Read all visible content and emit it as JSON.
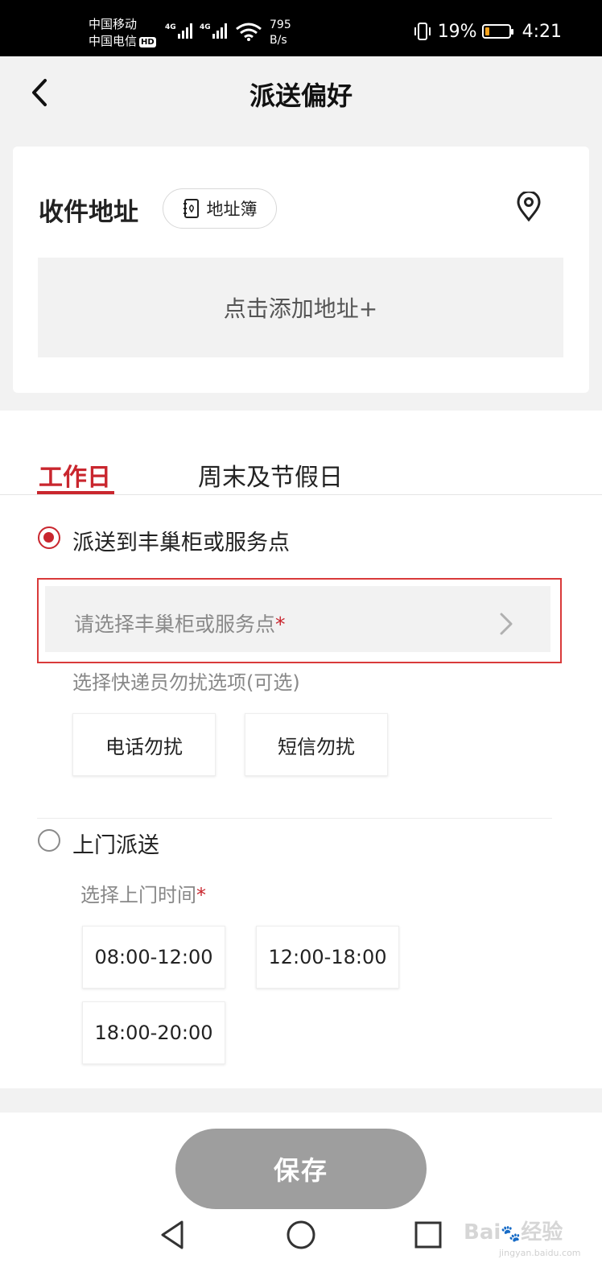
{
  "status_bar": {
    "carrier_1": "中国移动",
    "carrier_2": "中国电信",
    "hd_badge": "HD",
    "net_1": "4G",
    "net_2": "4G",
    "speed_value": "795",
    "speed_unit": "B/s",
    "battery_percent_text": "19%",
    "battery_level": 0.19,
    "time": "4:21"
  },
  "header": {
    "title": "派送偏好",
    "back_icon": "chevron-left-icon"
  },
  "address": {
    "title": "收件地址",
    "book_label": "地址簿",
    "book_icon": "address-book-icon",
    "location_icon": "location-pin-icon",
    "add_label": "点击添加地址+"
  },
  "tabs": [
    {
      "label": "工作日",
      "active": true
    },
    {
      "label": "周末及节假日",
      "active": false
    }
  ],
  "option_locker": {
    "label": "派送到丰巢柜或服务点",
    "selected": true,
    "picker_placeholder": "请选择丰巢柜或服务点",
    "required_mark": "*",
    "dnd_hint": "选择快递员勿扰选项(可选)",
    "dnd_options": [
      "电话勿扰",
      "短信勿扰"
    ]
  },
  "option_door": {
    "label": "上门派送",
    "selected": false,
    "time_hint": "选择上门时间",
    "required_mark": "*",
    "time_slots": [
      "08:00-12:00",
      "12:00-18:00",
      "18:00-20:00"
    ]
  },
  "footer": {
    "save_label": "保存"
  },
  "nav": {
    "back": "triangle-back-icon",
    "home": "circle-home-icon",
    "recent": "square-recent-icon"
  },
  "watermark": {
    "brand": "Bai",
    "brand_cn": "经验",
    "url": "jingyan.baidu.com"
  },
  "colors": {
    "accent": "#c9262e",
    "battery": "#f7a21b",
    "save_disabled": "#9e9e9e"
  }
}
